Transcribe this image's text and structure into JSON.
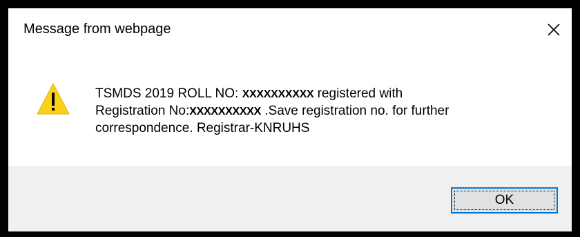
{
  "dialog": {
    "title": "Message from webpage",
    "icon": "warning-icon",
    "message": {
      "part1": "TSMDS 2019 ROLL NO: ",
      "roll_no": "XXXXXXXXXX",
      "part2": " registered with",
      "part3": "Registration No:",
      "reg_no": "XXXXXXXXXX",
      "part4": " .Save registration no. for further",
      "part5": "correspondence. Registrar-KNRUHS"
    },
    "ok_label": "OK"
  },
  "colors": {
    "frame": "#000000",
    "footer": "#f0f0f0",
    "warning": "#fcd116",
    "focus_border": "#0078d7"
  }
}
